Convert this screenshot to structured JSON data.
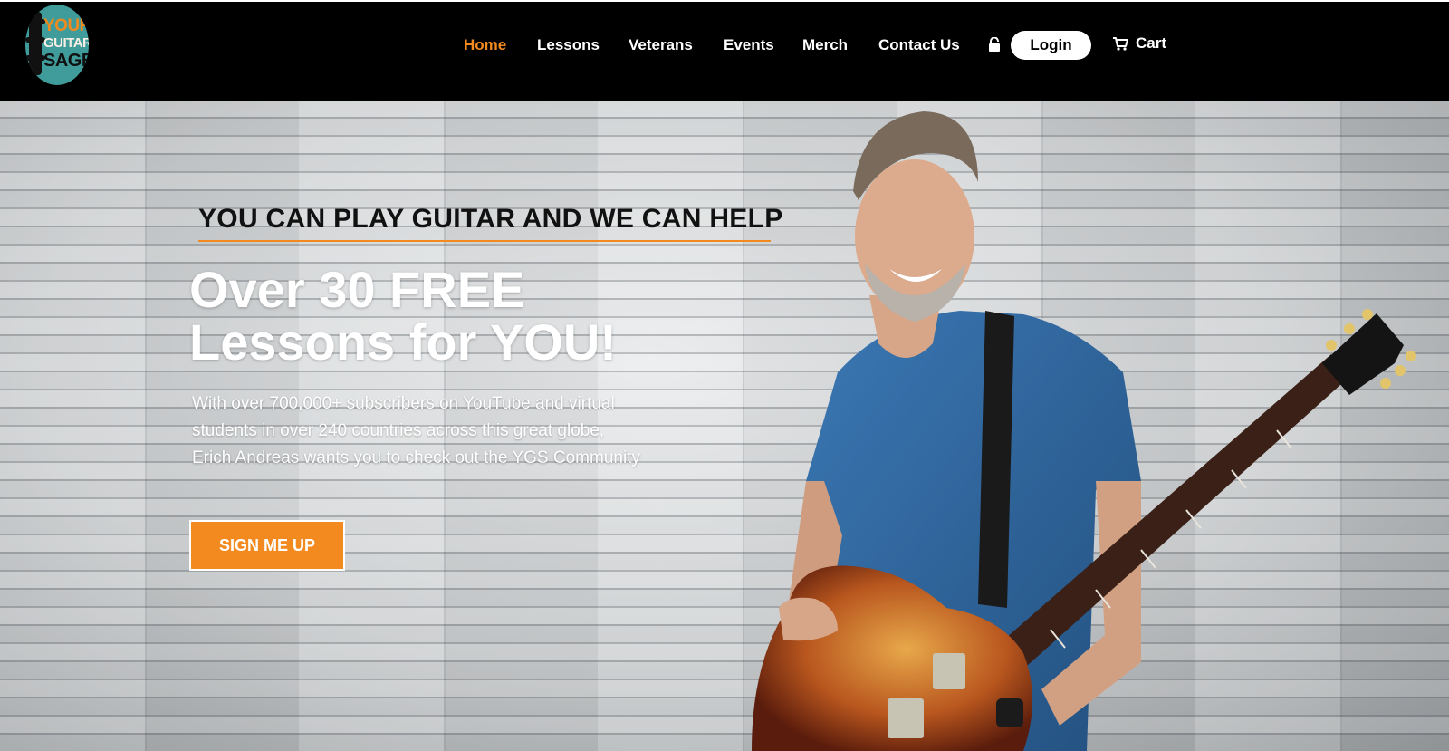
{
  "brand": {
    "logo_lines": [
      "YOUR",
      "GUITAR",
      "SAGE"
    ]
  },
  "nav": {
    "items": [
      {
        "label": "Home",
        "active": true
      },
      {
        "label": "Lessons",
        "active": false
      },
      {
        "label": "Veterans",
        "active": false
      },
      {
        "label": "Events",
        "active": false
      },
      {
        "label": "Merch",
        "active": false
      },
      {
        "label": "Contact Us",
        "active": false
      }
    ],
    "login_label": "Login",
    "cart_label": "Cart",
    "icons": [
      "lock-icon",
      "cart-icon"
    ]
  },
  "hero": {
    "tagline": "YOU CAN PLAY GUITAR AND WE CAN HELP",
    "headline_line1": "Over 30 FREE",
    "headline_line2": "Lessons for YOU!",
    "subtext": "With over 700,000+ subscribers on YouTube and virtual students in over 240 countries across this great globe, Erich Andreas wants you to check out the YGS Community",
    "cta_label": "SIGN ME UP"
  },
  "colors": {
    "accent": "#f28a1f",
    "header_bg": "#000000",
    "logo_bg": "#3f9c9a"
  }
}
